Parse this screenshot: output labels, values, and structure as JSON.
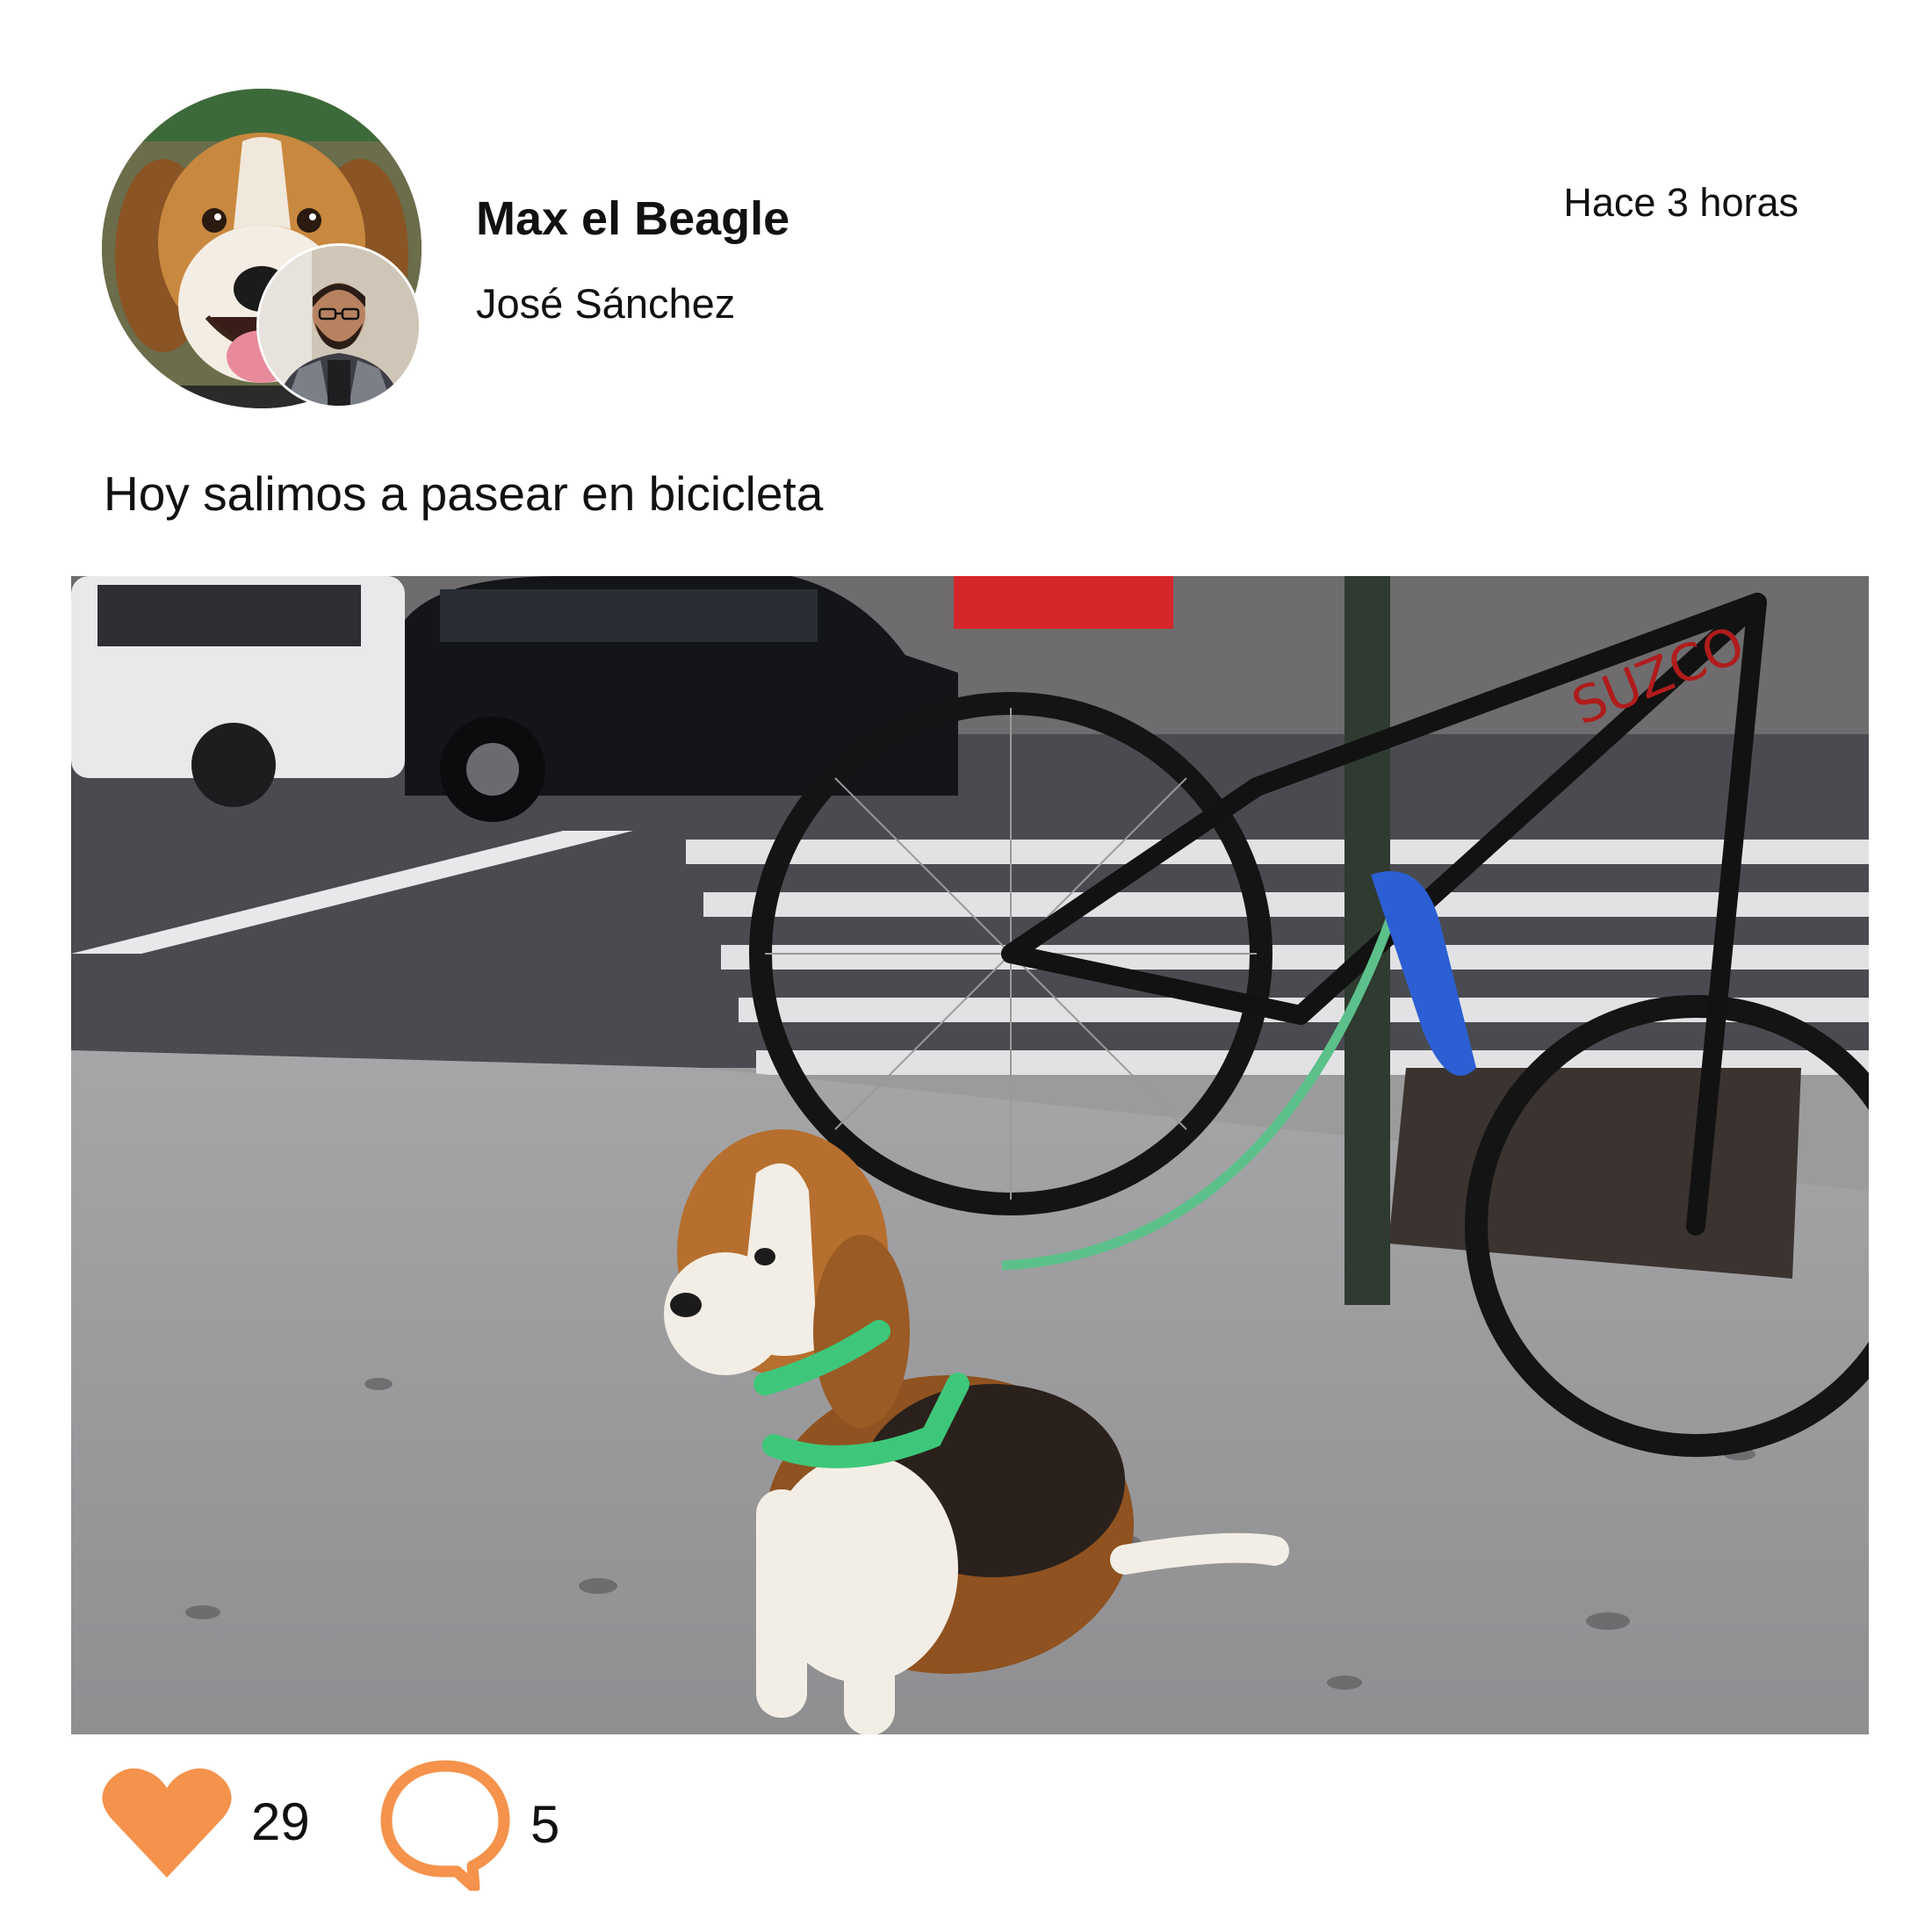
{
  "post": {
    "author": {
      "display_name": "Max el Beagle",
      "owner_name": "José Sánchez"
    },
    "timestamp": "Hace 3 horas",
    "caption": "Hoy salimos a pasear en bicicleta",
    "photo": {
      "subject": "beagle-leashed-to-bike-pole"
    },
    "actions": {
      "like": {
        "icon": "heart-icon",
        "count": "29",
        "color": "#F5924B"
      },
      "comment": {
        "icon": "speech-bubble-icon",
        "count": "5",
        "color": "#F5924B"
      }
    }
  }
}
